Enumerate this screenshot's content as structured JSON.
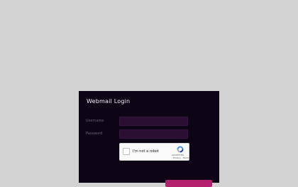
{
  "login": {
    "title": "Webmail Login",
    "username_label": "Username",
    "password_label": "Password",
    "username_value": "",
    "password_value": ""
  },
  "recaptcha": {
    "label": "I'm not a robot",
    "brand": "reCAPTCHA",
    "links": "Privacy - Terms",
    "logo_icon": "recaptcha-logo-icon"
  },
  "colors": {
    "page_background": "#d2d2d2",
    "panel_background": "#0d0416",
    "input_background": "#2a0f33",
    "accent": "#b3206c"
  }
}
